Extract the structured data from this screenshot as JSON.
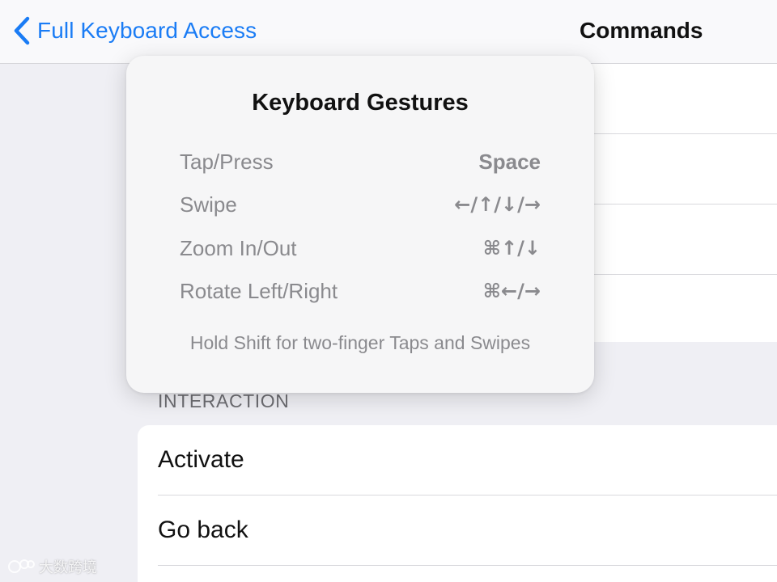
{
  "navbar": {
    "back_label": "Full Keyboard Access",
    "title": "Commands"
  },
  "popover": {
    "title": "Keyboard Gestures",
    "gestures": [
      {
        "label": "Tap/Press",
        "keys": "Space"
      },
      {
        "label": "Swipe",
        "keys": "←/↑/↓/→"
      },
      {
        "label": "Zoom In/Out",
        "keys": "⌘↑/↓"
      },
      {
        "label": "Rotate Left/Right",
        "keys": "⌘←/→"
      }
    ],
    "footnote": "Hold Shift for two-finger Taps and Swipes"
  },
  "interaction": {
    "header": "INTERACTION",
    "rows": [
      "Activate",
      "Go back"
    ]
  },
  "watermark": {
    "text": "大数跨境"
  },
  "colors": {
    "accent": "#1a7cf5",
    "background": "#efeff4",
    "secondary_text": "#8a8a8e"
  }
}
